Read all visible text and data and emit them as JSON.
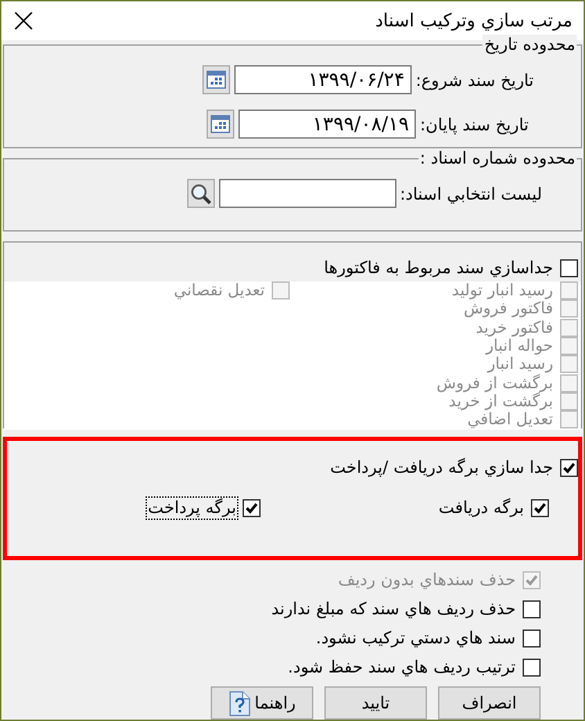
{
  "window": {
    "title": "مرتب سازي وترکيب اسناد"
  },
  "date_range": {
    "legend": "محدوده تاريخ",
    "fields": [
      {
        "label": "تاريخ سند شروع:",
        "value": "۱۳۹۹/۰۶/۲۴"
      },
      {
        "label": "تاريخ سند پايان:",
        "value": "۱۳۹۹/۰۸/۱۹"
      }
    ]
  },
  "document_range": {
    "legend": "محدوده شماره اسناد :",
    "field": {
      "label": "ليست انتخابي اسناد:"
    }
  },
  "invoice_split": {
    "label": "جداسازي سند مربوط به فاکتورها",
    "checked": false,
    "items": [
      {
        "label": "رسيد انبار توليد",
        "checked": false,
        "disabled": true
      },
      {
        "label": "فاکتور فروش",
        "checked": false,
        "disabled": true
      },
      {
        "label": "فاکتور خريد",
        "checked": false,
        "disabled": true
      },
      {
        "label": "حواله انبار",
        "checked": false,
        "disabled": true
      },
      {
        "label": "رسيد انبار",
        "checked": false,
        "disabled": true
      },
      {
        "label": "برگشت از فروش",
        "checked": false,
        "disabled": true
      },
      {
        "label": "برگشت از خريد",
        "checked": false,
        "disabled": true
      },
      {
        "label": "تعديل اضافي",
        "checked": false,
        "disabled": true
      }
    ],
    "side_items": [
      {
        "label": "تعديل نقصاني",
        "checked": false,
        "disabled": true
      }
    ]
  },
  "receipt_split": {
    "highlighted": true,
    "label": "جدا سازي برگه دريافت /پرداخت",
    "checked": true,
    "options": [
      {
        "label": "برگه دريافت",
        "checked": true,
        "focused": false
      },
      {
        "label": "برگه پرداخت",
        "checked": true,
        "focused": true
      }
    ]
  },
  "options": [
    {
      "label": "حذف سندهاي بدون رديف",
      "checked": true,
      "disabled": true
    },
    {
      "label": "حذف رديف هاي سند که مبلغ ندارند",
      "checked": false,
      "disabled": false
    },
    {
      "label": "سند هاي دستي ترکيب نشود.",
      "checked": false,
      "disabled": false
    },
    {
      "label": "ترتيب رديف هاي سند حفظ شود.",
      "checked": false,
      "disabled": false
    }
  ],
  "buttons": [
    {
      "label": "انصراف",
      "kind": "plain"
    },
    {
      "label": "تاييد",
      "kind": "plain"
    },
    {
      "label": "راهنما",
      "kind": "help"
    }
  ]
}
